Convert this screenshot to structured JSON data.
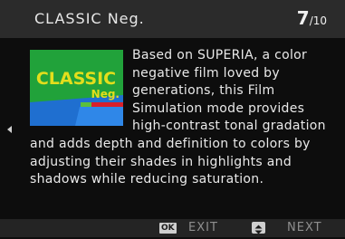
{
  "header": {
    "title": "CLASSIC Neg.",
    "page_current": "7",
    "page_total": "/10"
  },
  "thumbnail": {
    "logo_text": "CLASSIC",
    "logo_subtext": "Neg."
  },
  "description": {
    "lines": [
      "Based on SUPERIA, a color",
      "negative film loved by",
      "generations, this Film",
      "Simulation mode provides",
      "high-contrast tonal gradation",
      "and adds depth and definition to colors by",
      "adjusting their shades in highlights and",
      "shadows while reducing saturation."
    ]
  },
  "footer": {
    "ok_key": "OK",
    "exit_label": "EXIT",
    "next_label": "NEXT"
  },
  "icons": {
    "prev": "left-arrow-icon",
    "ok": "ok-key-icon",
    "nav": "up-down-key-icon"
  },
  "colors": {
    "header_bg": "#2b2b2b",
    "background": "#0d0d0d",
    "logo_green": "#21a23a",
    "logo_yellow": "#e3de1c",
    "thumb_blue": "#1f6fd0"
  }
}
